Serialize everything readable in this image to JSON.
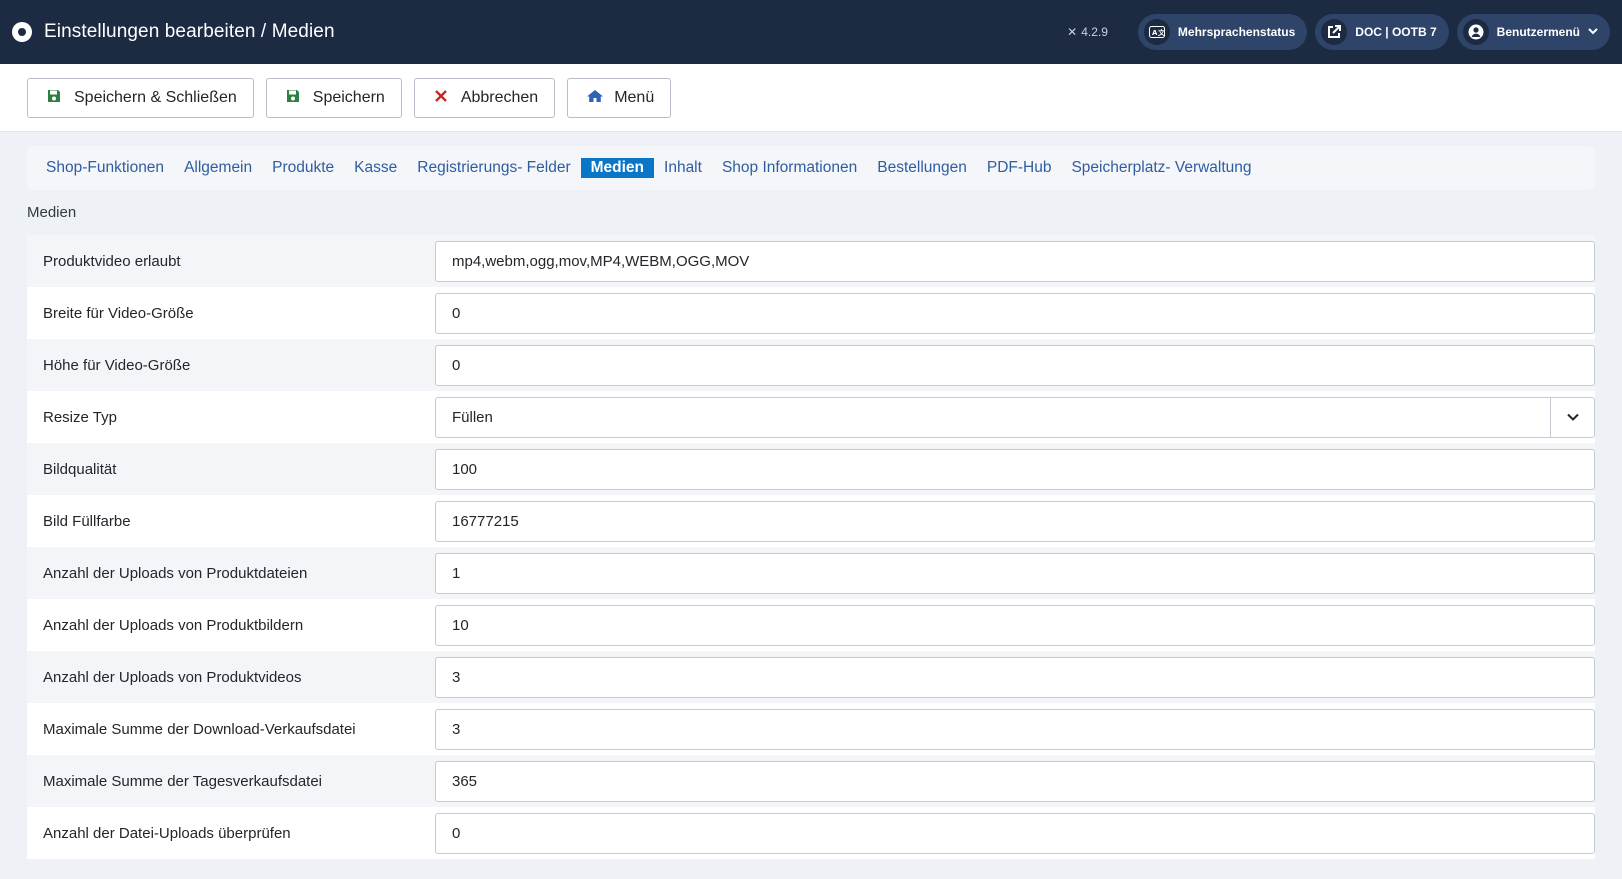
{
  "header": {
    "title": "Einstellungen bearbeiten / Medien",
    "version": "4.2.9",
    "pills": [
      {
        "label": "Mehrsprachenstatus",
        "icon": "language-icon"
      },
      {
        "label": "DOC | OOTB 7",
        "icon": "external-link-icon"
      },
      {
        "label": "Benutzermenü",
        "icon": "user-icon"
      }
    ]
  },
  "toolbar": {
    "save_close_label": "Speichern & Schließen",
    "save_label": "Speichern",
    "cancel_label": "Abbrechen",
    "menu_label": "Menü"
  },
  "tabs": [
    "Shop-Funktionen",
    "Allgemein",
    "Produkte",
    "Kasse",
    "Registrierungs- Felder",
    "Medien",
    "Inhalt",
    "Shop Informationen",
    "Bestellungen",
    "PDF-Hub",
    "Speicherplatz- Verwaltung"
  ],
  "active_tab": "Medien",
  "section_title": "Medien",
  "fields": [
    {
      "label": "Produktvideo erlaubt",
      "value": "mp4,webm,ogg,mov,MP4,WEBM,OGG,MOV"
    },
    {
      "label": "Breite für Video-Größe",
      "value": "0"
    },
    {
      "label": "Höhe für Video-Größe",
      "value": "0"
    },
    {
      "label": "Resize Typ",
      "value": "Füllen"
    },
    {
      "label": "Bildqualität",
      "value": "100"
    },
    {
      "label": "Bild Füllfarbe",
      "value": "16777215"
    },
    {
      "label": "Anzahl der Uploads von Produktdateien",
      "value": "1"
    },
    {
      "label": "Anzahl der Uploads von Produktbildern",
      "value": "10"
    },
    {
      "label": "Anzahl der Uploads von Produktvideos",
      "value": "3"
    },
    {
      "label": "Maximale Summe der Download-Verkaufsdatei",
      "value": "3"
    },
    {
      "label": "Maximale Summe der Tagesverkaufsdatei",
      "value": "365"
    },
    {
      "label": "Anzahl der Datei-Uploads überprüfen",
      "value": "0"
    }
  ]
}
